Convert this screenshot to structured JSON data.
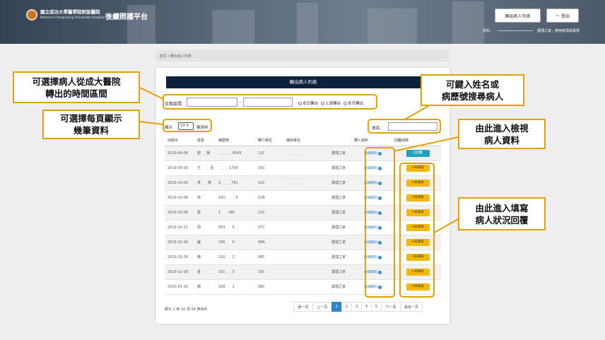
{
  "header": {
    "hospital_name_zh": "國立成功大學醫學院附設醫院",
    "hospital_name_en": "National Cheng Kung University Hospital",
    "system_name": "後續照護平台",
    "transfer_list_button": "轉出病人列表",
    "logout_button": "登出",
    "welcome_prefix": "您好，",
    "welcome_suffix": "護理之家，使用者測試帳號"
  },
  "breadcrumb": {
    "home": "首頁",
    "separator": "/",
    "current": "轉出病人列表"
  },
  "card": {
    "title": "轉出病人列表",
    "date_range_label": "日期區間",
    "date_separator": "-",
    "radio_options": [
      "本日轉出",
      "上週轉出",
      "本月轉出"
    ],
    "show_prefix": "顯示",
    "show_value": "10",
    "show_suffix": "筆資料",
    "search_label": "搜尋："
  },
  "table": {
    "headers": [
      "出院日",
      "姓名",
      "病歷號",
      "轉介單位",
      "接收單位",
      "轉入資料",
      "回覆狀態"
    ],
    "rows": [
      {
        "date": "2019-09-08",
        "name": "劉 ﹍ 萬",
        "mrn": "﹍﹍﹍﹍8565",
        "unit": "12C",
        "recv_prefix": "﹍﹍﹍﹍﹍",
        "recv": "護理之家",
        "detail": "詳細資料",
        "status": "已回覆",
        "replied": true
      },
      {
        "date": "2019-09-30",
        "name": "王　 ﹍ 昱",
        "mrn": "﹍﹍﹍1709",
        "unit": "10C",
        "recv_prefix": "",
        "recv": "護理之家",
        "detail": "詳細資料",
        "status": "未填寫",
        "replied": false
      },
      {
        "date": "2019-10-02",
        "name": "李﹍﹍英",
        "mrn": "0﹍﹍﹍761",
        "unit": "12C",
        "recv_prefix": "﹍﹍﹍﹍﹍",
        "recv": "護理之家",
        "detail": "詳細資料",
        "status": "未填寫",
        "replied": false
      },
      {
        "date": "2019-10-06",
        "name": "林",
        "mrn": "191﹍﹍﹍5",
        "unit": "10B",
        "recv_prefix": "",
        "recv": "護理之家",
        "detail": "詳細資料",
        "status": "未填寫",
        "replied": false
      },
      {
        "date": "2019-10-08",
        "name": "蔡",
        "mrn": "1　　 l96",
        "unit": "12C",
        "recv_prefix": "",
        "recv": "護理之家",
        "detail": "詳細資料",
        "status": "未填寫",
        "replied": false
      },
      {
        "date": "2019-10-11",
        "name": "周",
        "mrn": "003　　5",
        "unit": "07C",
        "recv_prefix": "",
        "recv": "護理之家",
        "detail": "詳細資料",
        "status": "未填寫",
        "replied": false
      },
      {
        "date": "2019-10-16",
        "name": "盧",
        "mrn": "195　　0",
        "unit": "08A",
        "recv_prefix": "",
        "recv": "護理之家",
        "detail": "詳細資料",
        "status": "未填寫",
        "replied": false
      },
      {
        "date": "2019-10-30",
        "name": "陳",
        "mrn": "192﹍﹍2",
        "unit": "08C",
        "recv_prefix": "",
        "recv": "護理之家",
        "detail": "詳細資料",
        "status": "未填寫",
        "replied": false
      },
      {
        "date": "2019-12-18",
        "name": "金",
        "mrn": "191﹍﹍3",
        "unit": "10C",
        "recv_prefix": "",
        "recv": "護理之家",
        "detail": "詳細資料",
        "status": "未填寫",
        "replied": false
      },
      {
        "date": "2020-01-10",
        "name": "楊",
        "mrn": "168　　1",
        "unit": "08C",
        "recv_prefix": "",
        "recv": "護理之家",
        "detail": "詳細資料",
        "status": "未填寫",
        "replied": false
      }
    ]
  },
  "footer": {
    "summary": "顯示 1 到 10 項 54 筆資料",
    "pager": [
      "第一頁",
      "上一頁",
      "1",
      "2",
      "3",
      "4",
      "5",
      "下一頁",
      "最後一頁"
    ],
    "active_page": "1"
  },
  "annotations": {
    "date_range": [
      "可選擇病人從成大醫院",
      "轉出的時間區間"
    ],
    "per_page": [
      "可選擇每頁顯示",
      "幾筆資料"
    ],
    "search": [
      "可鍵入姓名或",
      "病歷號搜尋病人"
    ],
    "view": [
      "由此進入檢視",
      "病人資料"
    ],
    "reply": [
      "由此進入填寫",
      "病人狀況回覆"
    ]
  },
  "colors": {
    "title_bar": "#0d223f",
    "accent_blue": "#2e86c8",
    "pending_yellow": "#f5b800",
    "replied_teal": "#1aa6c0",
    "annotation_border": "#e3a000"
  }
}
